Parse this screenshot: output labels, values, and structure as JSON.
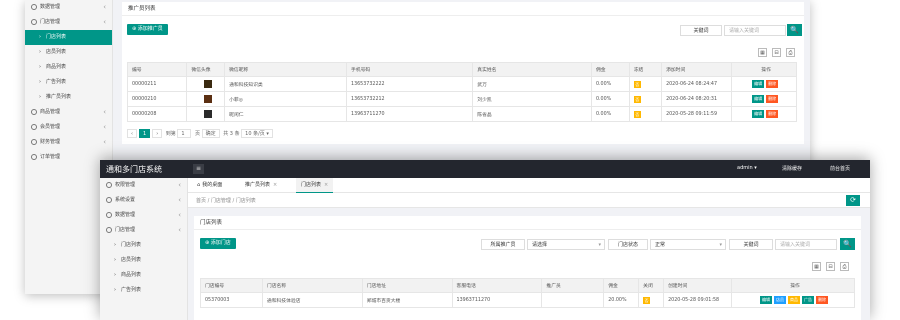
{
  "back": {
    "sidebar": [
      {
        "label": "数据管理",
        "icon": "gauge-icon",
        "chev": "‹",
        "sub": false,
        "active": false
      },
      {
        "label": "门店管理",
        "icon": "store-icon",
        "chev": "‹",
        "sub": false,
        "active": false
      },
      {
        "label": "门店列表",
        "icon": "",
        "chev": "",
        "sub": true,
        "active": true
      },
      {
        "label": "店员列表",
        "icon": "",
        "chev": "",
        "sub": true,
        "active": false
      },
      {
        "label": "商品列表",
        "icon": "",
        "chev": "",
        "sub": true,
        "active": false
      },
      {
        "label": "广告列表",
        "icon": "",
        "chev": "",
        "sub": true,
        "active": false
      },
      {
        "label": "推广员列表",
        "icon": "",
        "chev": "",
        "sub": true,
        "active": false
      },
      {
        "label": "商品管理",
        "icon": "box-icon",
        "chev": "‹",
        "sub": false,
        "active": false
      },
      {
        "label": "会员管理",
        "icon": "user-icon",
        "chev": "‹",
        "sub": false,
        "active": false
      },
      {
        "label": "财务管理",
        "icon": "money-icon",
        "chev": "‹",
        "sub": false,
        "active": false
      },
      {
        "label": "订单管理",
        "icon": "order-icon",
        "chev": "",
        "sub": false,
        "active": false
      }
    ],
    "title": "推广员列表",
    "add_button": "⊕ 添加推广员",
    "keyword_label": "关键词",
    "keyword_placeholder": "请输入关键词",
    "search_icon": "🔍",
    "tools": [
      "▦",
      "⊟",
      "⎙"
    ],
    "columns": [
      "编号",
      "微信头像",
      "微信昵称",
      "手机号码",
      "真实姓名",
      "佣金",
      "冻结",
      "添加时间",
      "操作"
    ],
    "rows": [
      {
        "id": "00000211",
        "avatar_color": "#3a2a10",
        "nick": "通和科技知识类",
        "phone": "13653732222",
        "name": "武万",
        "commission": "0.00%",
        "frozen": "否",
        "time": "2020-06-24 08:24:47"
      },
      {
        "id": "00000210",
        "avatar_color": "#5b2f12",
        "nick": "小菲◎",
        "phone": "13653732212",
        "name": "刘少凯",
        "commission": "0.00%",
        "frozen": "否",
        "time": "2020-06-24 08:20:31"
      },
      {
        "id": "00000208",
        "avatar_color": "#2b2b2b",
        "nick": "昵闲仁",
        "phone": "13963711270",
        "name": "陈省晶",
        "commission": "0.00%",
        "frozen": "否",
        "time": "2020-05-28 09:11:59"
      }
    ],
    "action_edit": "编辑",
    "action_delete": "删除",
    "pager": {
      "prev": "‹",
      "page": "1",
      "next": "›",
      "goto": "到第",
      "input": "1",
      "page_unit": "页",
      "confirm": "确定",
      "total": "共 3 条",
      "size": "10 条/页 ▾"
    }
  },
  "front": {
    "logo": "通和多门店系统",
    "menu_icon": "≡",
    "user": "admin ▾",
    "clear_cache": "清除缓存",
    "home": "前台首页",
    "sidebar": [
      {
        "label": "权限管理",
        "icon": "lock-icon",
        "chev": "‹",
        "sub": false,
        "active": false
      },
      {
        "label": "系统设置",
        "icon": "gear-icon",
        "chev": "‹",
        "sub": false,
        "active": false
      },
      {
        "label": "数据管理",
        "icon": "gauge-icon",
        "chev": "‹",
        "sub": false,
        "active": false
      },
      {
        "label": "门店管理",
        "icon": "store-icon",
        "chev": "‹",
        "sub": false,
        "active": false
      },
      {
        "label": "门店列表",
        "icon": "",
        "chev": "",
        "sub": true,
        "active": false
      },
      {
        "label": "店员列表",
        "icon": "",
        "chev": "",
        "sub": true,
        "active": false
      },
      {
        "label": "商品列表",
        "icon": "",
        "chev": "",
        "sub": true,
        "active": false
      },
      {
        "label": "广告列表",
        "icon": "",
        "chev": "",
        "sub": true,
        "active": false
      }
    ],
    "tabs": [
      {
        "label": "我的桌面",
        "closable": false,
        "active": false,
        "home": true
      },
      {
        "label": "推广员列表",
        "closable": true,
        "active": false,
        "home": false
      },
      {
        "label": "门店列表",
        "closable": true,
        "active": true,
        "home": false
      }
    ],
    "breadcrumb": "首页  /  门店管理  /  门店列表",
    "refresh_icon": "⟳",
    "title": "门店列表",
    "add_button": "⊕ 添加门店",
    "filter1_label": "所属推广员",
    "filter1_value": "请选择",
    "filter2_label": "门店状态",
    "filter2_value": "正常",
    "keyword_label": "关键词",
    "keyword_placeholder": "请输入关键词",
    "search_icon": "🔍",
    "tools": [
      "▦",
      "⊟",
      "⎙"
    ],
    "columns": [
      "门店编号",
      "门店名称",
      "门店地址",
      "客服电话",
      "推广员",
      "佣金",
      "关闭",
      "创建时间",
      "操作"
    ],
    "rows": [
      {
        "id": "05370003",
        "name": "通和科技体验店",
        "address": "郑城市百货大楼",
        "phone": "13963711270",
        "promoter": "",
        "commission": "20.00%",
        "closed": "否",
        "time": "2020-05-28 09:01:58"
      }
    ],
    "actions": [
      "编辑",
      "店员",
      "商品",
      "广告",
      "删除"
    ]
  }
}
